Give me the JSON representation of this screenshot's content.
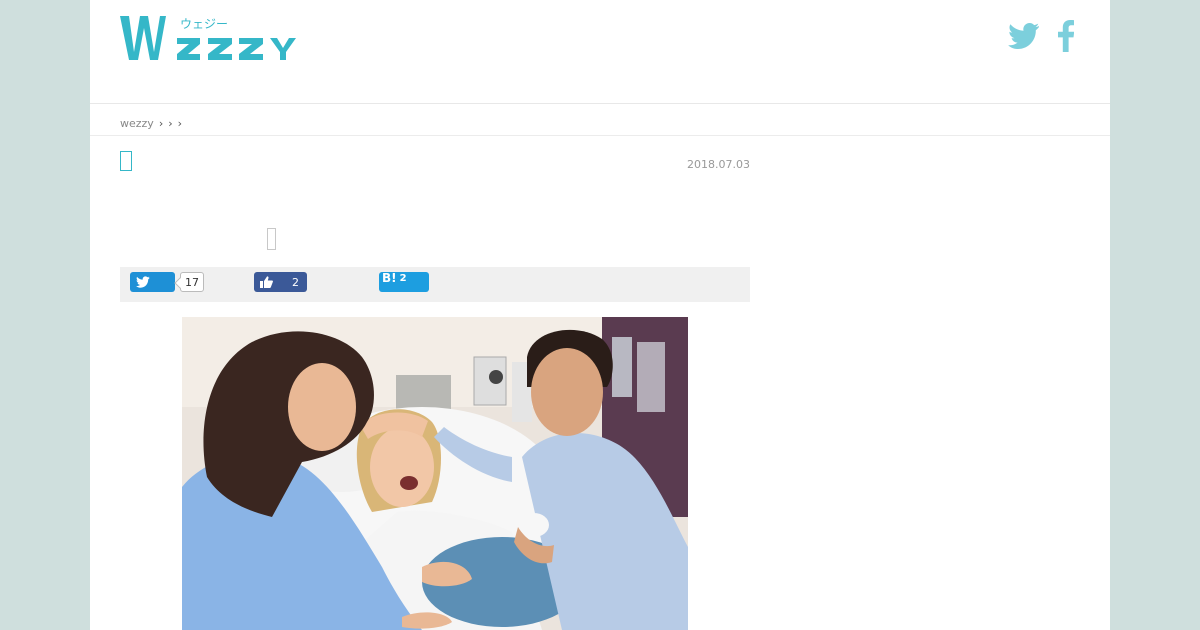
{
  "header": {
    "logo_text": "WEZZY",
    "logo_kana": "ウェジー",
    "social_icons": [
      "twitter-icon",
      "facebook-icon"
    ],
    "accent_color": "#35b7c8"
  },
  "breadcrumb": {
    "home": "wezzy",
    "separators": [
      "›",
      "›",
      "›"
    ]
  },
  "article": {
    "date": "2018.07.03",
    "photo_description_icon": "childbirth-photo"
  },
  "share": {
    "twitter_count": "17",
    "facebook_count": "2",
    "hatena_label": "B!",
    "hatena_count": "2",
    "colors": {
      "twitter": "#1e90d6",
      "facebook": "#3b5998",
      "hatena": "#1d9ee0"
    }
  }
}
